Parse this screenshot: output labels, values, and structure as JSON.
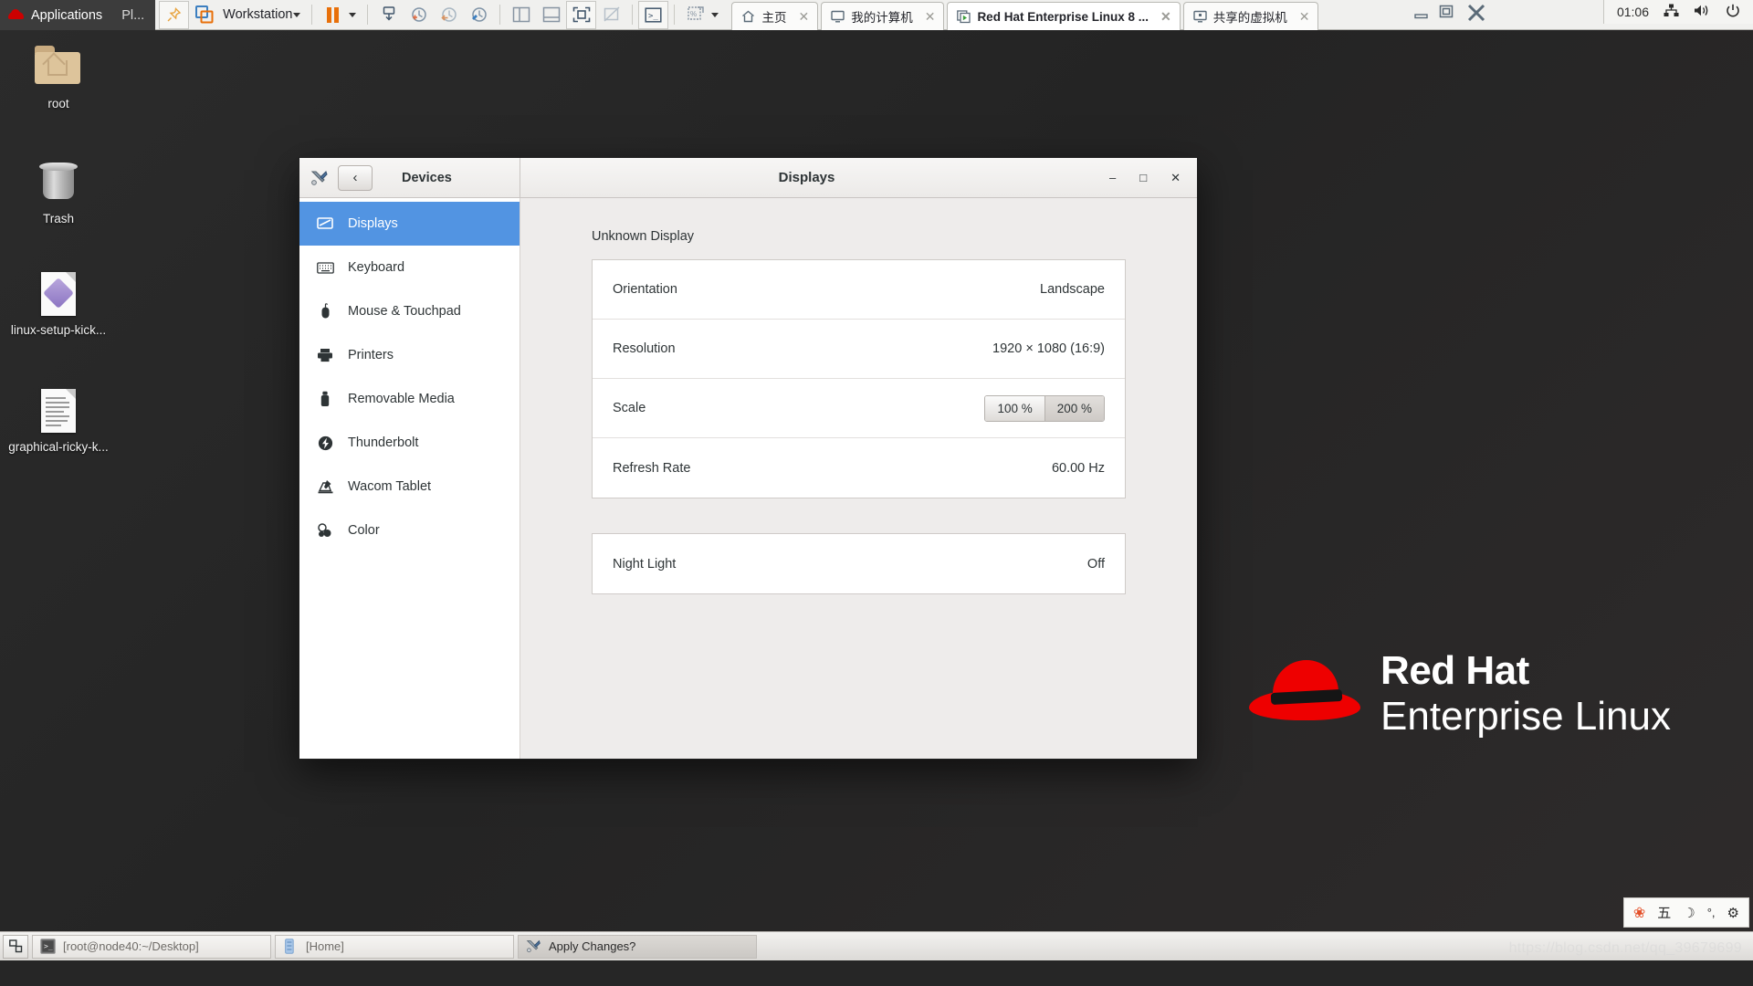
{
  "vmware": {
    "app_menu": {
      "applications": "Applications",
      "places": "Pl..."
    },
    "product_label": "Workstation",
    "toolbar_icons": [
      "pin-icon",
      "workstation-icon",
      "pause-icon",
      "snapshot-icon",
      "snapshot-take-icon",
      "snapshot-revert-icon",
      "snapshot-manager-icon",
      "sidebar-icon",
      "thumbnail-bar-icon",
      "fullscreen-icon",
      "unity-icon",
      "console-icon",
      "settings-icon"
    ],
    "tabs": [
      {
        "label": "主页",
        "icon": "home-icon",
        "active": false,
        "closable": true
      },
      {
        "label": "我的计算机",
        "icon": "monitor-icon",
        "active": false,
        "closable": true
      },
      {
        "label": "Red Hat Enterprise Linux 8 ...",
        "icon": "vm-running-icon",
        "active": true,
        "closable": true
      },
      {
        "label": "共享的虚拟机",
        "icon": "shared-vm-icon",
        "active": false,
        "closable": true
      }
    ],
    "window_controls": [
      "minimize-icon",
      "restore-icon",
      "close-icon"
    ]
  },
  "guest_status": {
    "clock": "01:06",
    "icons": [
      "network-icon",
      "volume-icon",
      "power-icon"
    ]
  },
  "desktop": {
    "icons": [
      {
        "name": "root",
        "type": "home-folder"
      },
      {
        "name": "Trash",
        "type": "trash"
      },
      {
        "name": "linux-setup-kick...",
        "type": "archive-file"
      },
      {
        "name": "graphical-ricky-k...",
        "type": "text-file"
      }
    ],
    "branding": {
      "line1": "Red Hat",
      "line2": "Enterprise Linux"
    }
  },
  "settings_window": {
    "title": "Displays",
    "header": {
      "tools_icon": "tools-icon",
      "back_label": "‹",
      "section_label": "Devices"
    },
    "window_buttons": {
      "minimize": "–",
      "maximize": "□",
      "close": "✕"
    },
    "sidebar": [
      {
        "label": "Displays",
        "icon": "display-icon",
        "selected": true
      },
      {
        "label": "Keyboard",
        "icon": "keyboard-icon",
        "selected": false
      },
      {
        "label": "Mouse & Touchpad",
        "icon": "mouse-icon",
        "selected": false
      },
      {
        "label": "Printers",
        "icon": "printer-icon",
        "selected": false
      },
      {
        "label": "Removable Media",
        "icon": "usb-icon",
        "selected": false
      },
      {
        "label": "Thunderbolt",
        "icon": "thunderbolt-icon",
        "selected": false
      },
      {
        "label": "Wacom Tablet",
        "icon": "tablet-icon",
        "selected": false
      },
      {
        "label": "Color",
        "icon": "color-icon",
        "selected": false
      }
    ],
    "panel": {
      "display_name": "Unknown Display",
      "rows": [
        {
          "label": "Orientation",
          "value": "Landscape"
        },
        {
          "label": "Resolution",
          "value": "1920 × 1080 (16:9)"
        },
        {
          "label": "Refresh Rate",
          "value": "60.00 Hz"
        }
      ],
      "scale": {
        "label": "Scale",
        "options": [
          {
            "label": "100 %",
            "selected": false
          },
          {
            "label": "200 %",
            "selected": true
          }
        ]
      },
      "night_light": {
        "label": "Night Light",
        "value": "Off"
      }
    }
  },
  "taskbar": {
    "show_desktop_icon": "show-desktop-icon",
    "items": [
      {
        "label": "[root@node40:~/Desktop]",
        "icon": "terminal-icon",
        "active": false
      },
      {
        "label": "[Home]",
        "icon": "files-icon",
        "active": false
      },
      {
        "label": "Apply Changes?",
        "icon": "tools-icon",
        "active": true
      }
    ],
    "tray": [
      {
        "icon": "baidu-paw-icon",
        "glyph": "❀"
      },
      {
        "icon": "ime-chinese-icon",
        "glyph": "五"
      },
      {
        "icon": "moon-icon",
        "glyph": "☽"
      },
      {
        "icon": "degree-icon",
        "glyph": "°,"
      },
      {
        "icon": "gear-icon",
        "glyph": "⚙"
      }
    ]
  },
  "watermark": "https://blog.csdn.net/qq_39679699"
}
